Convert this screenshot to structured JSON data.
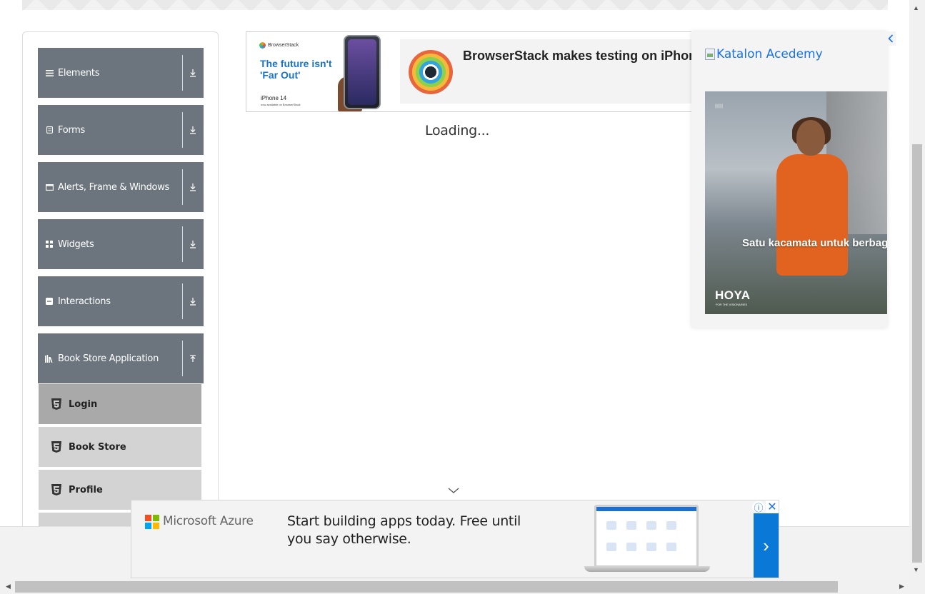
{
  "sidebar": {
    "groups": [
      {
        "label": "Elements",
        "icon": "hamburger-icon",
        "toggle": "download-arrow-icon"
      },
      {
        "label": "Forms",
        "icon": "form-icon",
        "toggle": "download-arrow-icon"
      },
      {
        "label": "Alerts, Frame & Windows",
        "icon": "window-icon",
        "toggle": "download-arrow-icon"
      },
      {
        "label": "Widgets",
        "icon": "grid-icon",
        "toggle": "download-arrow-icon"
      },
      {
        "label": "Interactions",
        "icon": "interactions-icon",
        "toggle": "download-arrow-icon"
      },
      {
        "label": "Book Store Application",
        "icon": "books-icon",
        "toggle": "upload-arrow-icon"
      }
    ],
    "bookstore_items": [
      {
        "label": "Login",
        "icon": "html5-icon",
        "active": true
      },
      {
        "label": "Book Store",
        "icon": "html5-icon",
        "active": false
      },
      {
        "label": "Profile",
        "icon": "html5-icon",
        "active": false
      }
    ]
  },
  "main": {
    "loading_text": "Loading..."
  },
  "top_ad": {
    "brand": "BrowserStack",
    "tagline": "The future isn't 'Far Out'",
    "product": "iPhone 14",
    "product_sub": "now available on BrowserStack",
    "headline": "BrowserStack makes testing on iPhone super easy. Access now on our real cloud"
  },
  "right_ad": {
    "image_alt": "Katalon Acedemy",
    "hoya_text": "Satu kacamata untuk berbagai aktivitas dengan Lensa Photochromic HOYA Sensity",
    "hoya_brand": "HOYA",
    "hoya_brand_sub": "FOR THE VISIONARIES",
    "close_glyph": "‹"
  },
  "bottom_ad": {
    "brand": "Microsoft Azure",
    "headline": "Start building apps today. Free until you say otherwise.",
    "arrow": "›",
    "info_glyph": "ⓘ",
    "close_glyph": "✕"
  },
  "colors": {
    "group_header_bg": "#6c757d",
    "menu_item_bg": "#d3d3d3",
    "menu_item_active_bg": "#a9a9a9",
    "azure_blue": "#0a78d7",
    "link_blue": "#1a73e8"
  }
}
